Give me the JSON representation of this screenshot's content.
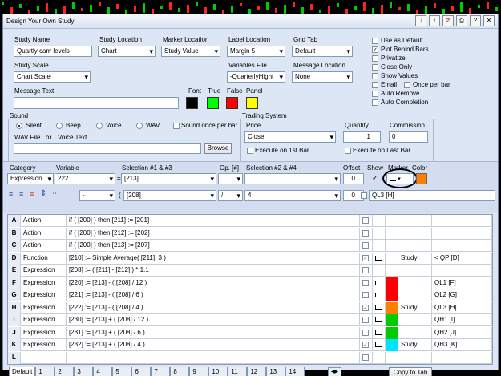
{
  "window": {
    "title": "Design Your Own Study"
  },
  "toolbar": {
    "icons": [
      "import-icon",
      "export-icon",
      "delete-icon",
      "print-icon",
      "help-icon",
      "close-icon"
    ],
    "glyphs": [
      "↓",
      "↑",
      "⊘",
      "⎙",
      "?",
      "✕"
    ]
  },
  "form": {
    "study_name": {
      "label": "Study Name",
      "value": "Quartly cam levels"
    },
    "study_location": {
      "label": "Study Location",
      "value": "Chart"
    },
    "marker_location": {
      "label": "Marker Location",
      "value": "Study Value"
    },
    "label_location": {
      "label": "Label Location",
      "value": "Margin 5"
    },
    "grid_tab": {
      "label": "Grid Tab",
      "value": "Default"
    },
    "study_scale": {
      "label": "Study Scale",
      "value": "Chart Scale"
    },
    "variables_file": {
      "label": "Variables File",
      "value": "-QuarterlyHight"
    },
    "message_location": {
      "label": "Message Location",
      "value": "None"
    },
    "message_text": {
      "label": "Message Text",
      "value": ""
    },
    "colors": {
      "font": {
        "label": "Font",
        "color": "#000000"
      },
      "true": {
        "label": "True",
        "color": "#00ff00"
      },
      "false": {
        "label": "False",
        "color": "#ff0000"
      },
      "panel": {
        "label": "Panel",
        "color": "#ffff00"
      }
    }
  },
  "options": [
    {
      "label": "Use as Default",
      "checked": false
    },
    {
      "label": "Plot Behind Bars",
      "checked": true
    },
    {
      "label": "Privatize",
      "checked": false
    },
    {
      "label": "Close Only",
      "checked": false
    },
    {
      "label": "Show Values",
      "checked": false
    },
    {
      "label": "Email",
      "checked": false
    },
    {
      "label": "Once per bar",
      "checked": false
    },
    {
      "label": "Auto Remove",
      "checked": false
    },
    {
      "label": "Auto Completion",
      "checked": false
    }
  ],
  "sound": {
    "title": "Sound",
    "options": [
      {
        "label": "Silent",
        "selected": true
      },
      {
        "label": "Beep",
        "selected": false
      },
      {
        "label": "Voice",
        "selected": false
      },
      {
        "label": "WAV",
        "selected": false
      }
    ],
    "once_per_bar": "Sound once per bar",
    "wav_label": "WAV File",
    "or": "or",
    "voice_label": "Voice Text",
    "browse": "Browse"
  },
  "trading": {
    "title": "Trading System",
    "price_label": "Price",
    "price_value": "Close",
    "quantity_label": "Quantity",
    "quantity_value": "1",
    "commission_label": "Commission",
    "commission_value": "0",
    "exec_first": "Execute on 1st Bar",
    "exec_last": "Execute on Last Bar"
  },
  "editor": {
    "headers": {
      "category": "Category",
      "variable": "Variable",
      "sel13": "Selection #1 & #3",
      "op": "Op. [#]",
      "sel24": "Selection #2 & #4",
      "offset": "Offset",
      "show": "Show",
      "marker": "Marker",
      "color": "Color"
    },
    "category": "Expression",
    "variable": "222",
    "eq": "=",
    "sel1": "[213]",
    "op1": "",
    "sel2": "",
    "offset1": "0",
    "show_marker": "✓",
    "accent_color": "#ff8000",
    "row2_op": "-",
    "row2_bracket": "(",
    "sel3": "[208]",
    "op2": "/",
    "sel4": "4",
    "offset2": "0",
    "label": "QL3 [H]"
  },
  "rows": [
    {
      "key": "A",
      "type": "Action",
      "formula": "if ( [200] ) then [211] := [201]",
      "show": false,
      "marker": false,
      "color": "",
      "plot": "",
      "label": ""
    },
    {
      "key": "B",
      "type": "Action",
      "formula": "if ( [200] ) then [212] := [202]",
      "show": false,
      "marker": false,
      "color": "",
      "plot": "",
      "label": ""
    },
    {
      "key": "C",
      "type": "Action",
      "formula": "if ( [200] ) then [213] := [207]",
      "show": false,
      "marker": false,
      "color": "",
      "plot": "",
      "label": ""
    },
    {
      "key": "D",
      "type": "Function",
      "formula": "[210] := Simple Average( [211], 3 )",
      "show": true,
      "marker": true,
      "color": "",
      "plot": "Study",
      "label": "< QP [D]"
    },
    {
      "key": "E",
      "type": "Expression",
      "formula": "[208] := ( [211] - [212] ) * 1.1",
      "show": false,
      "marker": false,
      "color": "",
      "plot": "",
      "label": ""
    },
    {
      "key": "F",
      "type": "Expression",
      "formula": "[220] := [213] - ( [208] / 12 )",
      "show": false,
      "marker": true,
      "color": "#ff0000",
      "plot": "",
      "label": "QL1 [F]"
    },
    {
      "key": "G",
      "type": "Expression",
      "formula": "[221] := [213] - ( [208] / 6 )",
      "show": false,
      "marker": true,
      "color": "#ff0000",
      "plot": "",
      "label": "QL2 [G]"
    },
    {
      "key": "H",
      "type": "Expression",
      "formula": "[222] := [213] - ( [208] / 4 )",
      "show": true,
      "marker": true,
      "color": "#ff8000",
      "plot": "Study",
      "label": "QL3 [H]"
    },
    {
      "key": "I",
      "type": "Expression",
      "formula": "[230] := [213] + ( [208] / 12 )",
      "show": false,
      "marker": true,
      "color": "#00cc00",
      "plot": "",
      "label": "QH1 [I]"
    },
    {
      "key": "J",
      "type": "Expression",
      "formula": "[231] := [213] + ( [208] / 6 )",
      "show": false,
      "marker": true,
      "color": "#00cc00",
      "plot": "",
      "label": "QH2 [J]"
    },
    {
      "key": "K",
      "type": "Expression",
      "formula": "[232] := [213] + ( [208] / 4 )",
      "show": true,
      "marker": true,
      "color": "#00e5ff",
      "plot": "Study",
      "label": "QH3 [K]"
    },
    {
      "key": "L",
      "type": "",
      "formula": "",
      "show": false,
      "marker": false,
      "color": "",
      "plot": "",
      "label": ""
    }
  ],
  "tabs": {
    "items": [
      "Default",
      "1",
      "2",
      "3",
      "4",
      "5",
      "6",
      "7",
      "8",
      "9",
      "10",
      "11",
      "12",
      "13",
      "14"
    ],
    "nav": "◀▶",
    "tab_label": "Tab",
    "tab_value": "Default",
    "copy_to_tab": "Copy to Tab"
  }
}
